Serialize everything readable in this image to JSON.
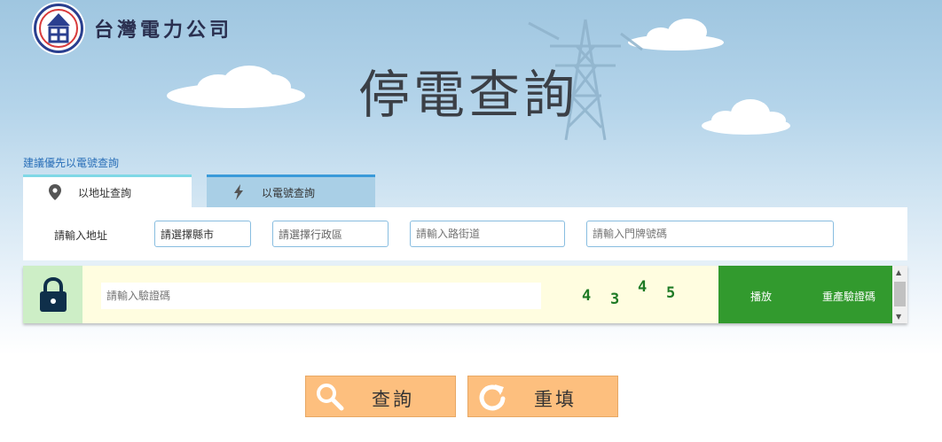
{
  "header": {
    "company_name": "台灣電力公司",
    "page_title": "停電查詢"
  },
  "hint": "建議優先以電號查詢",
  "tabs": [
    {
      "label": "以地址查詢",
      "icon": "map-pin-icon"
    },
    {
      "label": "以電號查詢",
      "icon": "lightning-icon"
    }
  ],
  "address": {
    "label": "請輸入地址",
    "county_select": "請選擇縣市",
    "district_select": "請選擇行政區",
    "road_placeholder": "請輸入路街道",
    "number_placeholder": "請輸入門牌號碼"
  },
  "captcha": {
    "placeholder": "請輸入驗證碼",
    "digits": [
      "4",
      "3",
      "4",
      "5"
    ],
    "play_label": "播放",
    "regenerate_label": "重產驗證碼"
  },
  "buttons": {
    "query_label": "查詢",
    "reset_label": "重填"
  },
  "colors": {
    "button_orange": "#fdbf7e",
    "captcha_green": "#329a2e",
    "tab_active_top": "#7fd8e6",
    "tab_inactive_bg": "#a9cfe6"
  }
}
